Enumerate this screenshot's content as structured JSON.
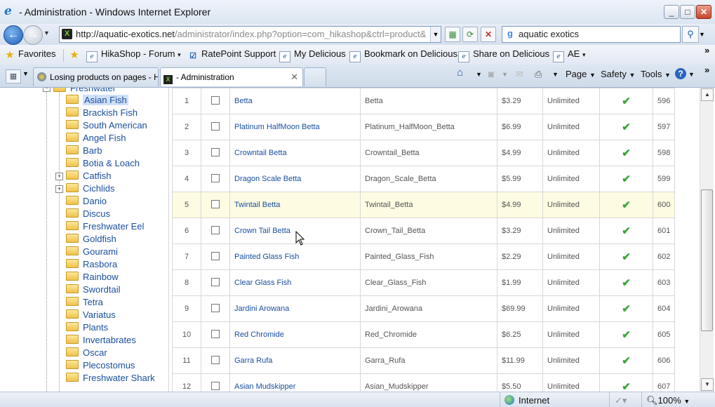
{
  "window": {
    "title": "- Administration - Windows Internet Explorer",
    "minimize": "_",
    "maximize": "□",
    "close": "✕"
  },
  "address": {
    "url_host": "http://aquatic-exotics.net",
    "url_path": "/administrator/index.php?option=com_hikashop&ctrl=product&",
    "search_value": "aquatic exotics"
  },
  "favorites_bar": {
    "favorites_label": "Favorites",
    "links": [
      "HikaShop - Forum",
      "RatePoint Support",
      "My Delicious",
      "Bookmark on Delicious",
      "Share on Delicious",
      "AE"
    ]
  },
  "tabs": [
    {
      "label": "Losing products on pages - H..."
    },
    {
      "label": "- Administration"
    }
  ],
  "command_bar": {
    "page": "Page",
    "safety": "Safety",
    "tools": "Tools"
  },
  "category_tree": {
    "root": "Freshwater",
    "items": [
      {
        "label": "Asian Fish",
        "selected": true
      },
      {
        "label": "Brackish Fish"
      },
      {
        "label": "South American"
      },
      {
        "label": "Angel Fish"
      },
      {
        "label": "Barb"
      },
      {
        "label": "Botia & Loach"
      },
      {
        "label": "Catfish",
        "expandable": true
      },
      {
        "label": "Cichlids",
        "expandable": true
      },
      {
        "label": "Danio"
      },
      {
        "label": "Discus"
      },
      {
        "label": "Freshwater Eel"
      },
      {
        "label": "Goldfish"
      },
      {
        "label": "Gourami"
      },
      {
        "label": "Rasbora"
      },
      {
        "label": "Rainbow"
      },
      {
        "label": "Swordtail"
      },
      {
        "label": "Tetra"
      },
      {
        "label": "Variatus"
      },
      {
        "label": "Plants"
      },
      {
        "label": "Invertabrates"
      },
      {
        "label": "Oscar"
      },
      {
        "label": "Plecostomus"
      },
      {
        "label": "Freshwater Shark"
      }
    ]
  },
  "products": [
    {
      "num": "1",
      "name": "Betta",
      "code": "Betta",
      "price": "$3.29",
      "qty": "Unlimited",
      "id": "596"
    },
    {
      "num": "2",
      "name": "Platinum HalfMoon Betta",
      "code": "Platinum_HalfMoon_Betta",
      "price": "$6.99",
      "qty": "Unlimited",
      "id": "597"
    },
    {
      "num": "3",
      "name": "Crowntail Betta",
      "code": "Crowntail_Betta",
      "price": "$4.99",
      "qty": "Unlimited",
      "id": "598"
    },
    {
      "num": "4",
      "name": "Dragon Scale Betta",
      "code": "Dragon_Scale_Betta",
      "price": "$5.99",
      "qty": "Unlimited",
      "id": "599"
    },
    {
      "num": "5",
      "name": "Twintail Betta",
      "code": "Twintail_Betta",
      "price": "$4.99",
      "qty": "Unlimited",
      "id": "600",
      "highlight": true
    },
    {
      "num": "6",
      "name": "Crown Tail Betta",
      "code": "Crown_Tail_Betta",
      "price": "$3.29",
      "qty": "Unlimited",
      "id": "601"
    },
    {
      "num": "7",
      "name": "Painted Glass Fish",
      "code": "Painted_Glass_Fish",
      "price": "$2.29",
      "qty": "Unlimited",
      "id": "602"
    },
    {
      "num": "8",
      "name": "Clear Glass Fish",
      "code": "Clear_Glass_Fish",
      "price": "$1.99",
      "qty": "Unlimited",
      "id": "603"
    },
    {
      "num": "9",
      "name": "Jardini Arowana",
      "code": "Jardini_Arowana",
      "price": "$69.99",
      "qty": "Unlimited",
      "id": "604"
    },
    {
      "num": "10",
      "name": "Red Chromide",
      "code": "Red_Chromide",
      "price": "$6.25",
      "qty": "Unlimited",
      "id": "605"
    },
    {
      "num": "11",
      "name": "Garra Rufa",
      "code": "Garra_Rufa",
      "price": "$11.99",
      "qty": "Unlimited",
      "id": "606"
    },
    {
      "num": "12",
      "name": "Asian Mudskipper",
      "code": "Asian_Mudskipper",
      "price": "$5.50",
      "qty": "Unlimited",
      "id": "607"
    }
  ],
  "status_bar": {
    "zone": "Internet",
    "zoom": "100%"
  },
  "colors": {
    "link": "#1a4fa0",
    "highlight_row": "#fdfbe2",
    "published_tick": "#3aa53a"
  }
}
